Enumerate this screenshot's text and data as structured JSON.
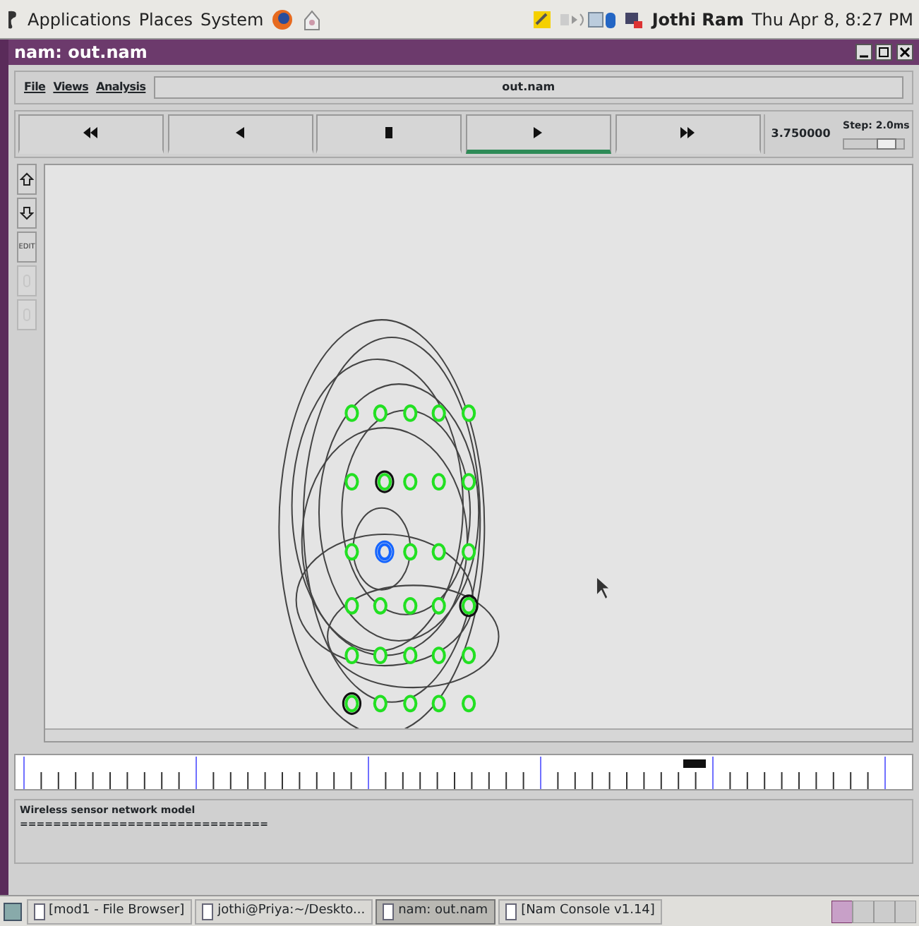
{
  "top_panel": {
    "menus": [
      "Applications",
      "Places",
      "System"
    ],
    "user": "Jothi Ram",
    "clock": "Thu Apr 8, 8:27 PM"
  },
  "window": {
    "title": "nam: out.nam"
  },
  "menu": [
    "File",
    "Views",
    "Analysis"
  ],
  "file_name": "out.nam",
  "playback_buttons": [
    {
      "kind": "rewind",
      "selected": false
    },
    {
      "kind": "back",
      "selected": false
    },
    {
      "kind": "stop",
      "selected": false
    },
    {
      "kind": "play",
      "selected": true
    },
    {
      "kind": "forward",
      "selected": false
    }
  ],
  "time": "3.750000",
  "step": {
    "label": "Step: 2.0ms",
    "level": 0.72
  },
  "side_tools": [
    {
      "kind": "zoom-in",
      "disabled": false
    },
    {
      "kind": "zoom-out",
      "disabled": false
    },
    {
      "kind": "edit",
      "label": "EDIT",
      "disabled": false
    },
    {
      "kind": "slot",
      "disabled": true
    },
    {
      "kind": "slot",
      "disabled": true
    }
  ],
  "annotations": [
    "Wireless sensor network model",
    "=============================="
  ],
  "taskbar": [
    {
      "label": "[mod1 - File Browser]",
      "selected": false
    },
    {
      "label": "jothi@Priya:~/Deskto...",
      "selected": false
    },
    {
      "label": "nam: out.nam",
      "selected": true
    },
    {
      "label": "[Nam Console v1.14]",
      "selected": false
    }
  ]
}
